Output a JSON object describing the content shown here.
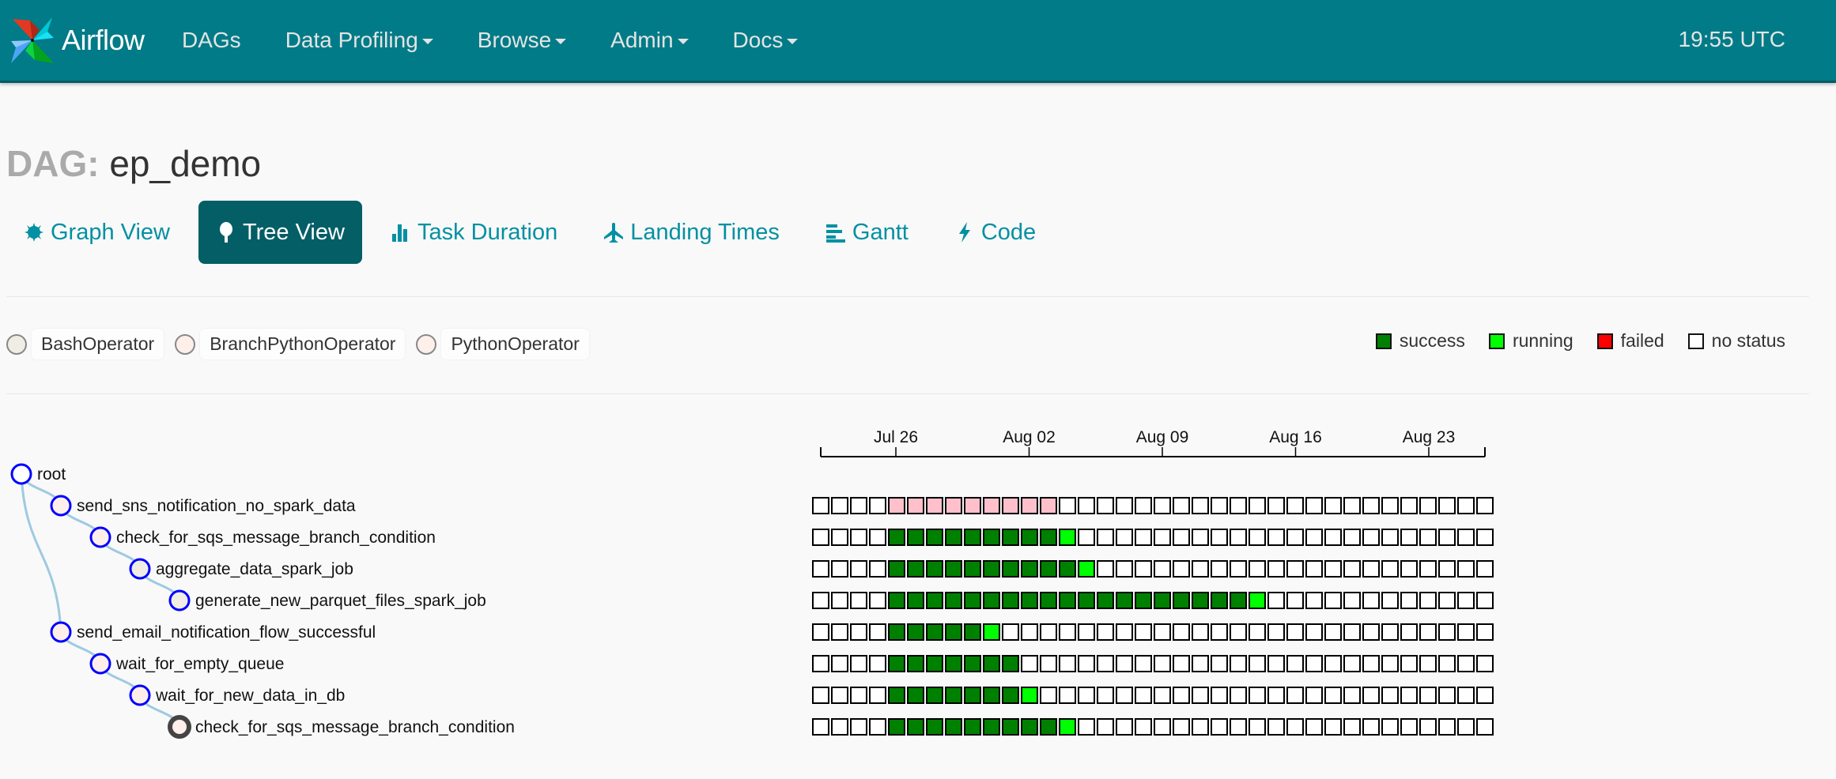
{
  "navbar": {
    "brand": "Airflow",
    "items": [
      {
        "label": "DAGs",
        "dropdown": false
      },
      {
        "label": "Data Profiling",
        "dropdown": true
      },
      {
        "label": "Browse",
        "dropdown": true
      },
      {
        "label": "Admin",
        "dropdown": true
      },
      {
        "label": "Docs",
        "dropdown": true
      }
    ],
    "clock": "19:55 UTC"
  },
  "dag": {
    "label": "DAG:",
    "name": "ep_demo"
  },
  "tabs": [
    {
      "label": "Graph View",
      "icon": "asterisk-icon",
      "active": false
    },
    {
      "label": "Tree View",
      "icon": "tree-icon",
      "active": true
    },
    {
      "label": "Task Duration",
      "icon": "bar-chart-icon",
      "active": false
    },
    {
      "label": "Landing Times",
      "icon": "plane-icon",
      "active": false
    },
    {
      "label": "Gantt",
      "icon": "align-left-icon",
      "active": false
    },
    {
      "label": "Code",
      "icon": "bolt-icon",
      "active": false
    }
  ],
  "operators": [
    {
      "name": "BashOperator",
      "color": "#f0ede4"
    },
    {
      "name": "BranchPythonOperator",
      "color": "#ffefeb"
    },
    {
      "name": "PythonOperator",
      "color": "#ffefeb"
    }
  ],
  "statuses": [
    {
      "name": "success",
      "color": "#008000"
    },
    {
      "name": "running",
      "color": "#00ff00"
    },
    {
      "name": "failed",
      "color": "#ff0000"
    },
    {
      "name": "no status",
      "color": "#ffffff"
    }
  ],
  "state_colors": {
    "success": "#008000",
    "running": "#00ff00",
    "skipped": "#ffc0cb",
    "none": "#ffffff"
  },
  "timeline": {
    "ticks": [
      "Jul 26",
      "Aug 02",
      "Aug 09",
      "Aug 16",
      "Aug 23"
    ],
    "num_runs": 36
  },
  "tree": {
    "root_label": "root",
    "tasks": [
      {
        "name": "send_sns_notification_no_spark_data",
        "depth": 1,
        "operator": "PythonOperator",
        "runs": [
          [
            "none",
            4
          ],
          [
            "skipped",
            9
          ],
          [
            "none",
            23
          ]
        ]
      },
      {
        "name": "check_for_sqs_message_branch_condition",
        "depth": 2,
        "operator": "BranchPythonOperator",
        "runs": [
          [
            "none",
            4
          ],
          [
            "success",
            9
          ],
          [
            "running",
            1
          ],
          [
            "none",
            22
          ]
        ]
      },
      {
        "name": "aggregate_data_spark_job",
        "depth": 3,
        "operator": "BashOperator",
        "runs": [
          [
            "none",
            4
          ],
          [
            "success",
            10
          ],
          [
            "running",
            1
          ],
          [
            "none",
            21
          ]
        ]
      },
      {
        "name": "generate_new_parquet_files_spark_job",
        "depth": 4,
        "operator": "BashOperator",
        "runs": [
          [
            "none",
            4
          ],
          [
            "success",
            19
          ],
          [
            "running",
            1
          ],
          [
            "none",
            12
          ]
        ]
      },
      {
        "name": "send_email_notification_flow_successful",
        "depth": 1,
        "operator": "PythonOperator",
        "runs": [
          [
            "none",
            4
          ],
          [
            "success",
            5
          ],
          [
            "running",
            1
          ],
          [
            "none",
            26
          ]
        ]
      },
      {
        "name": "wait_for_empty_queue",
        "depth": 2,
        "operator": "PythonOperator",
        "runs": [
          [
            "none",
            4
          ],
          [
            "success",
            7
          ],
          [
            "none",
            25
          ]
        ]
      },
      {
        "name": "wait_for_new_data_in_db",
        "depth": 3,
        "operator": "PythonOperator",
        "runs": [
          [
            "none",
            4
          ],
          [
            "success",
            7
          ],
          [
            "running",
            1
          ],
          [
            "none",
            24
          ]
        ]
      },
      {
        "name": "check_for_sqs_message_branch_condition",
        "depth": 4,
        "operator": "BranchPythonOperator",
        "collapsed": true,
        "runs": [
          [
            "none",
            4
          ],
          [
            "success",
            9
          ],
          [
            "running",
            1
          ],
          [
            "none",
            22
          ]
        ]
      }
    ]
  }
}
